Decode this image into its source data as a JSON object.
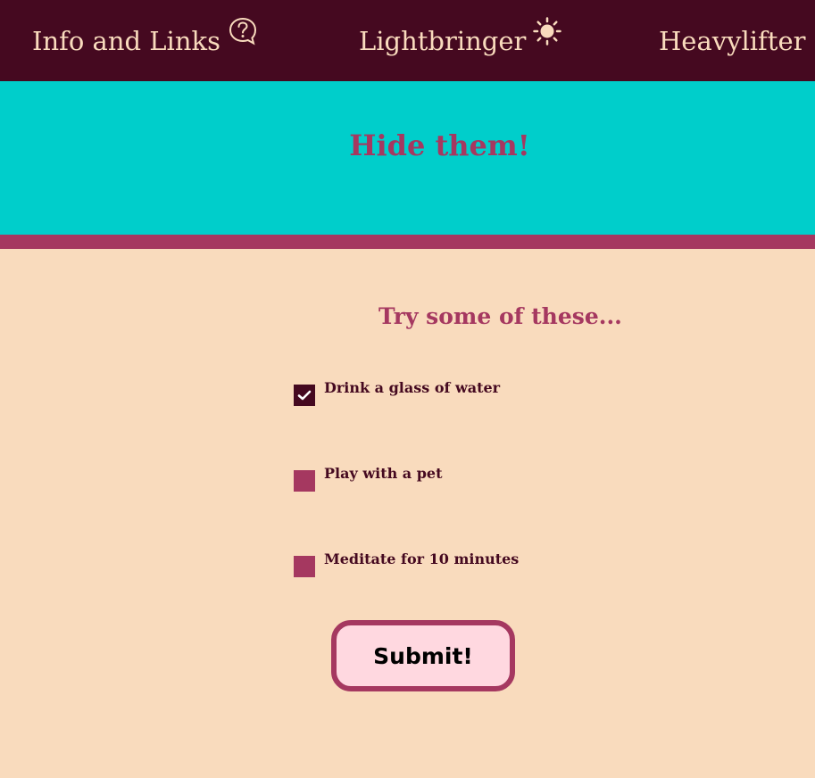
{
  "nav": {
    "items": [
      {
        "label": "Info and Links",
        "icon": "question-bubble-icon"
      },
      {
        "label": "Lightbringer",
        "icon": "sun-icon"
      },
      {
        "label": "Heavylifter"
      }
    ]
  },
  "banner": {
    "title": "Hide them!"
  },
  "tasks": {
    "title": "Try some of these...",
    "items": [
      {
        "label": "Drink a glass of water",
        "checked": true
      },
      {
        "label": "Play with a pet",
        "checked": false
      },
      {
        "label": "Meditate for 10 minutes",
        "checked": false
      }
    ],
    "submit_label": "Submit!"
  },
  "colors": {
    "nav_bg": "#450920",
    "nav_text": "#f9dbbd",
    "banner_bg": "#00cecb",
    "accent": "#a53860",
    "page_bg": "#f9dbbd",
    "button_bg": "#ffd8e0"
  }
}
